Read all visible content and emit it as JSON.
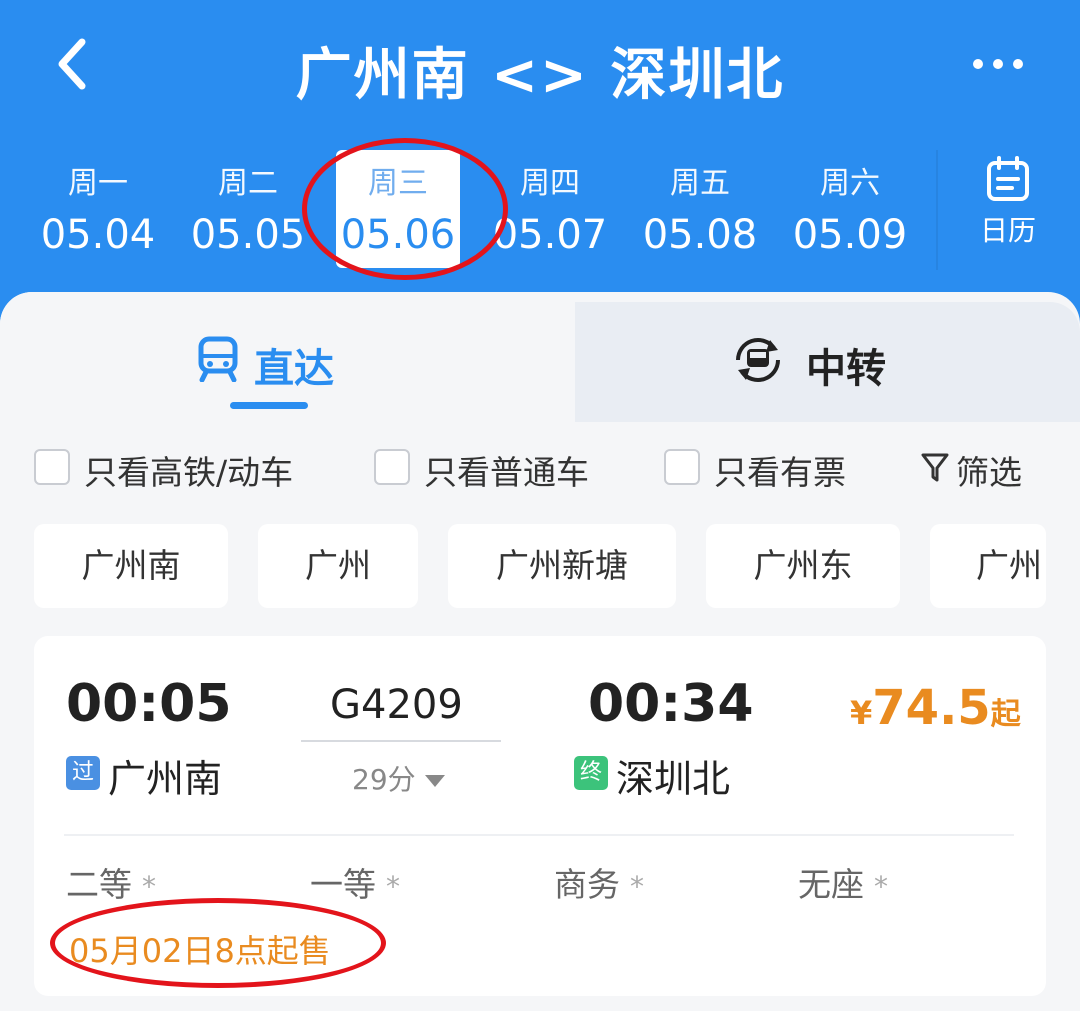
{
  "header": {
    "title": "广州南 <> 深圳北",
    "back_icon": "chevron-left-icon",
    "more_icon": "more-dots-icon",
    "background": "#2a8df0"
  },
  "dates": [
    {
      "weekday": "周一",
      "date": "05.04"
    },
    {
      "weekday": "周二",
      "date": "05.05"
    },
    {
      "weekday": "周三",
      "date": "05.06",
      "selected": true
    },
    {
      "weekday": "周四",
      "date": "05.07"
    },
    {
      "weekday": "周五",
      "date": "05.08"
    },
    {
      "weekday": "周六",
      "date": "05.09"
    }
  ],
  "calendar": {
    "label": "日历",
    "icon": "calendar-icon"
  },
  "tabs": [
    {
      "label": "直达",
      "icon": "train-icon",
      "active": true
    },
    {
      "label": "中转",
      "icon": "transfer-icon",
      "active": false
    }
  ],
  "filters": [
    {
      "label": "只看高铁/动车",
      "checked": false
    },
    {
      "label": "只看普通车",
      "checked": false
    },
    {
      "label": "只看有票",
      "checked": false
    }
  ],
  "filter_button": {
    "label": "筛选",
    "icon": "funnel-icon"
  },
  "stations": [
    "广州南",
    "广州",
    "广州新塘",
    "广州东",
    "广州"
  ],
  "train": {
    "depart_time": "00:05",
    "train_no": "G4209",
    "arrive_time": "00:34",
    "duration": "29分",
    "price_symbol": "¥",
    "price": "74.5",
    "price_suffix": "起",
    "from_tag": "过",
    "from_station": "广州南",
    "to_tag": "终",
    "to_station": "深圳北",
    "seats": [
      {
        "label": "二等",
        "mark": "*"
      },
      {
        "label": "一等",
        "mark": "*"
      },
      {
        "label": "商务",
        "mark": "*"
      },
      {
        "label": "无座",
        "mark": "*"
      }
    ],
    "sale_notice": "05月02日8点起售"
  },
  "colors": {
    "accent": "#2a8df0",
    "price": "#e98b20",
    "highlight_ring": "#e3141b",
    "pass_tag": "#4a90e2",
    "end_tag": "#3cc37b"
  }
}
